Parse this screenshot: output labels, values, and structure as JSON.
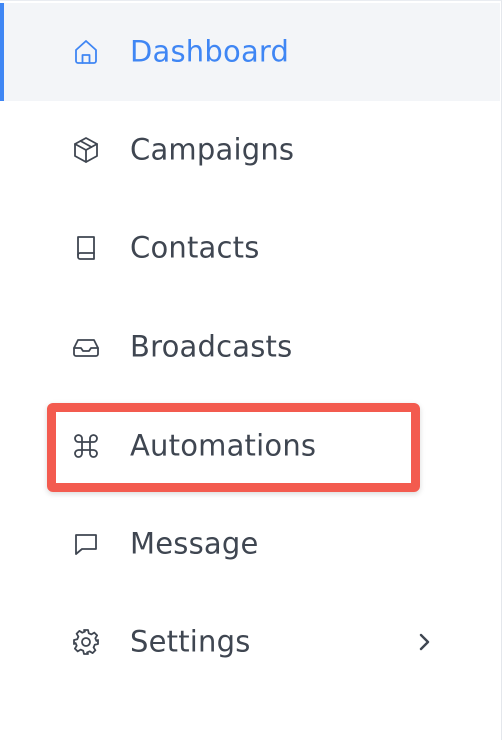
{
  "sidebar": {
    "accent_color": "#3f86f4",
    "highlight_color": "#f35b4f",
    "items": [
      {
        "label": "Dashboard",
        "icon": "home-icon",
        "active": true
      },
      {
        "label": "Campaigns",
        "icon": "cube-icon"
      },
      {
        "label": "Contacts",
        "icon": "book-icon"
      },
      {
        "label": "Broadcasts",
        "icon": "inbox-icon"
      },
      {
        "label": "Automations",
        "icon": "command-icon",
        "highlighted": true
      },
      {
        "label": "Message",
        "icon": "chat-bubble-icon"
      },
      {
        "label": "Settings",
        "icon": "gear-icon",
        "has_submenu": true
      }
    ]
  }
}
